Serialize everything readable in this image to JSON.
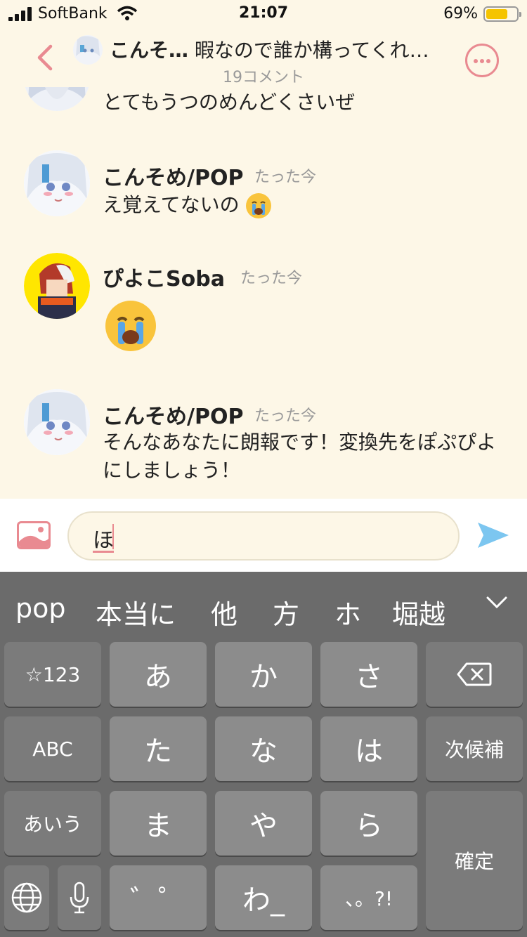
{
  "status_bar": {
    "carrier": "SoftBank",
    "time": "21:07",
    "battery": "69%"
  },
  "header": {
    "user": "こんそ…",
    "title": "暇なので誰か構ってくれ…",
    "comment_count": "19コメント"
  },
  "comments": [
    {
      "name": "",
      "time": "",
      "text": "とてもうつのめんどくさいぜ"
    },
    {
      "name": "こんそめ/POP",
      "time": "たった今",
      "text": "え覚えてないの"
    },
    {
      "name": "ぴよこSoba",
      "time": "たった今",
      "text": ""
    },
    {
      "name": "こんそめ/POP",
      "time": "たった今",
      "text": "そんなあなたに朗報です！変換先をぽぷぴよにしましょう！"
    }
  ],
  "input": {
    "value": "ほ"
  },
  "keyboard": {
    "candidates": [
      "pop",
      "本当に",
      "他",
      "方",
      "ホ",
      "堀越"
    ],
    "keys": {
      "num": "☆123",
      "a": "あ",
      "ka": "か",
      "sa": "さ",
      "abc": "ABC",
      "ta": "た",
      "na": "な",
      "ha": "は",
      "next": "次候補",
      "aiu": "あいう",
      "ma": "ま",
      "ya": "や",
      "ra": "ら",
      "confirm": "確定",
      "dakuten": "゛゜",
      "wa": "わ_",
      "punct": "、。?!"
    }
  },
  "colors": {
    "accent": "#e98a91",
    "send": "#7cc6f0",
    "background": "#fdf7e7",
    "keyboard": "#6b6b6b"
  }
}
